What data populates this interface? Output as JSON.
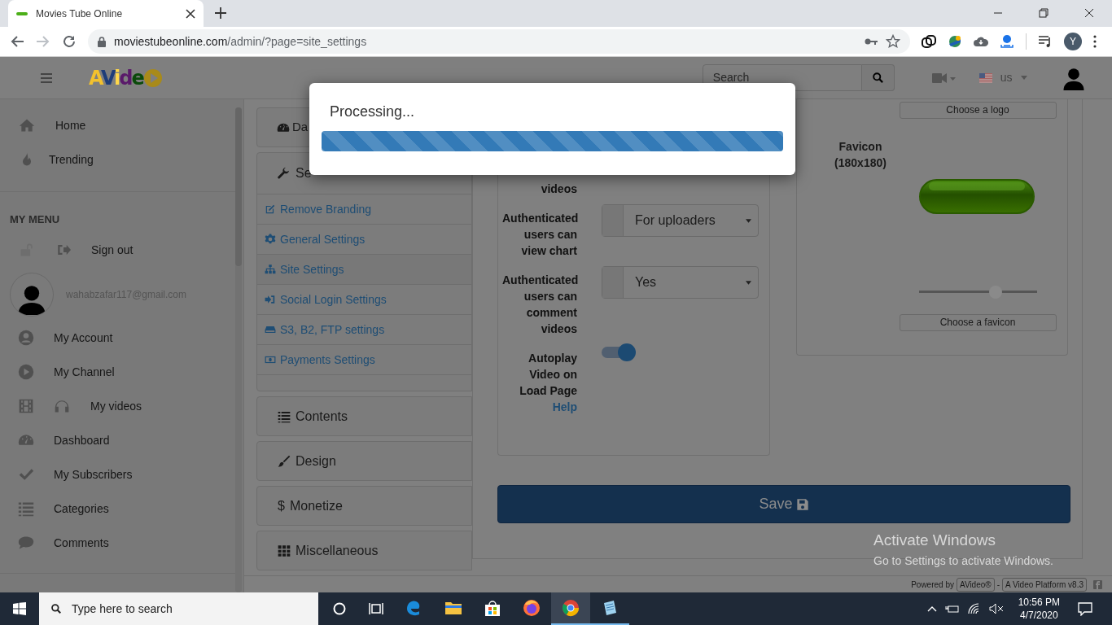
{
  "browser": {
    "tabs": [
      {
        "title": "Movies Tube Online",
        "selected": true
      }
    ],
    "address": {
      "host": "moviestubeonline.com",
      "path": "/admin/?page=site_settings"
    },
    "forward_disabled": true,
    "profile_initial": "Y"
  },
  "navbar": {
    "logo": "AVide",
    "search": {
      "placeholder": "Search"
    },
    "language": "us"
  },
  "sidebar": {
    "top_items": [
      "Home",
      "Trending"
    ],
    "section_title": "MY MENU",
    "sign_out": "Sign out",
    "user_email": "wahabzafar117@gmail.com",
    "menu_items": [
      "My Account",
      "My Channel",
      "My videos",
      "Dashboard",
      "My Subscribers",
      "Categories",
      "Comments"
    ]
  },
  "settings_nav": [
    {
      "label": "Da",
      "expanded": false
    },
    {
      "label": "Se",
      "expanded": true,
      "items": [
        {
          "label": "Remove Branding",
          "selected": false
        },
        {
          "label": "General Settings",
          "selected": false
        },
        {
          "label": "Site Settings",
          "selected": true
        },
        {
          "label": "Social Login Settings",
          "selected": false
        },
        {
          "label": "S3, B2, FTP settings",
          "selected": false
        },
        {
          "label": "Payments Settings",
          "selected": false
        }
      ]
    },
    {
      "label": "Contents",
      "expanded": false
    },
    {
      "label": "Design",
      "expanded": false
    },
    {
      "label": "Monetize",
      "glyph": "$",
      "expanded": false
    },
    {
      "label": "Miscellaneous",
      "expanded": false
    }
  ],
  "form": {
    "fields": [
      {
        "kind": "note",
        "label": "videos"
      },
      {
        "kind": "select",
        "label": "Authenticated users can view chart",
        "value": "For uploaders"
      },
      {
        "kind": "select",
        "label": "Authenticated users can comment videos",
        "value": "Yes"
      },
      {
        "kind": "switch",
        "label": "Autoplay Video on Load Page",
        "help": "Help",
        "on": true
      }
    ]
  },
  "images": {
    "logo_button": "Choose a logo",
    "favicon_label": "Favicon",
    "favicon_size": "(180x180)",
    "zoom": {
      "level": 0.65
    },
    "favicon_button": "Choose a favicon"
  },
  "save_button": "Save",
  "footer": {
    "powered_by": "Powered by",
    "badges": [
      "AVideo®",
      "A Video Platform v8.3"
    ],
    "separator": "-"
  },
  "modal": {
    "title": "Processing...",
    "progress": {
      "level": 1
    }
  },
  "os_notice": {
    "title": "Activate Windows",
    "text": "Go to Settings to activate Windows."
  },
  "taskbar": {
    "search_placeholder": "Type here to search",
    "apps": [
      {
        "running": false,
        "selected": false
      },
      {
        "running": false,
        "selected": false
      },
      {
        "running": false,
        "selected": false
      },
      {
        "running": false,
        "selected": false
      },
      {
        "running": true,
        "selected": true
      },
      {
        "running": true,
        "selected": false
      }
    ],
    "time": "10:56 PM",
    "date": "4/7/2020"
  }
}
